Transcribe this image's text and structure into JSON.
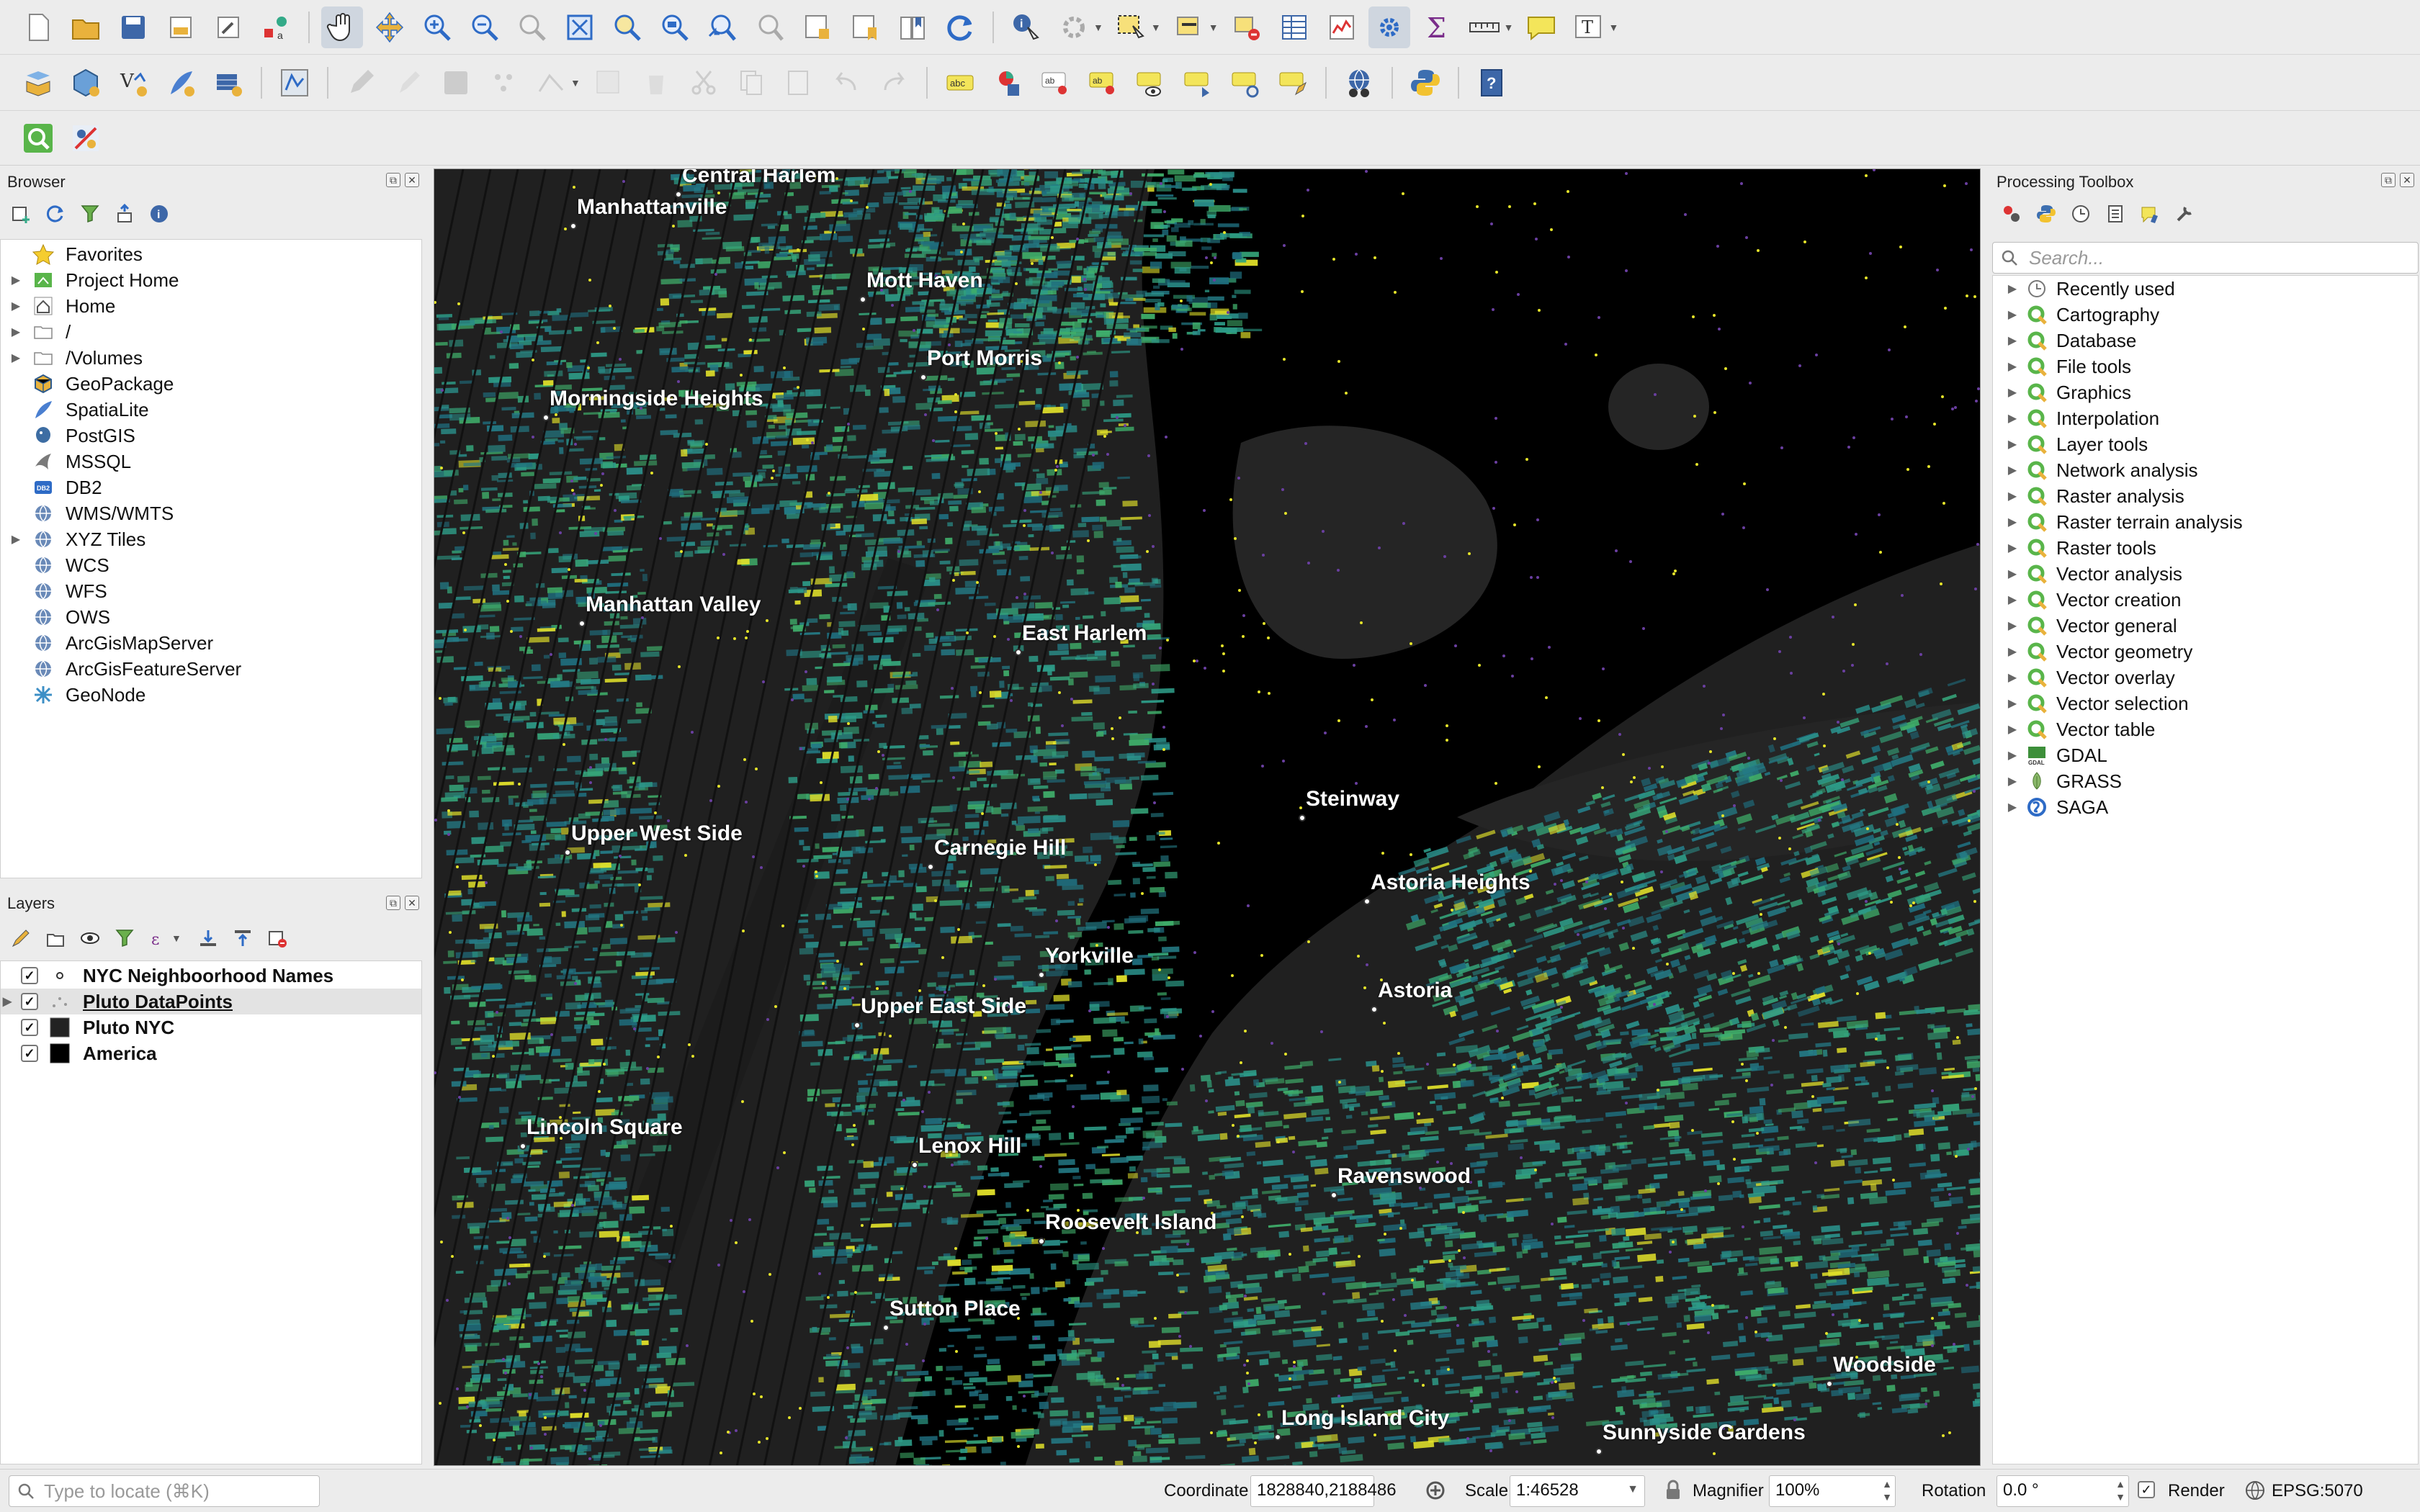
{
  "browser": {
    "title": "Browser",
    "items": [
      {
        "label": "Favorites",
        "icon": "star-icon",
        "expandable": false
      },
      {
        "label": "Project Home",
        "icon": "project-home-icon",
        "expandable": true
      },
      {
        "label": "Home",
        "icon": "home-icon",
        "expandable": true
      },
      {
        "label": "/",
        "icon": "folder-icon",
        "expandable": true
      },
      {
        "label": "/Volumes",
        "icon": "folder-icon",
        "expandable": true
      },
      {
        "label": "GeoPackage",
        "icon": "geopackage-icon",
        "expandable": false
      },
      {
        "label": "SpatiaLite",
        "icon": "spatialite-icon",
        "expandable": false
      },
      {
        "label": "PostGIS",
        "icon": "postgis-icon",
        "expandable": false
      },
      {
        "label": "MSSQL",
        "icon": "mssql-icon",
        "expandable": false
      },
      {
        "label": "DB2",
        "icon": "db2-icon",
        "expandable": false
      },
      {
        "label": "WMS/WMTS",
        "icon": "globe-icon",
        "expandable": false
      },
      {
        "label": "XYZ Tiles",
        "icon": "globe-icon",
        "expandable": true
      },
      {
        "label": "WCS",
        "icon": "globe-icon",
        "expandable": false
      },
      {
        "label": "WFS",
        "icon": "globe-icon",
        "expandable": false
      },
      {
        "label": "OWS",
        "icon": "globe-icon",
        "expandable": false
      },
      {
        "label": "ArcGisMapServer",
        "icon": "globe-icon",
        "expandable": false
      },
      {
        "label": "ArcGisFeatureServer",
        "icon": "globe-icon",
        "expandable": false
      },
      {
        "label": "GeoNode",
        "icon": "geonode-icon",
        "expandable": false
      }
    ]
  },
  "layers": {
    "title": "Layers",
    "items": [
      {
        "label": "NYC Neighboorhood Names",
        "checked": true,
        "symbol": "point",
        "selected": false,
        "expandable": false
      },
      {
        "label": "Pluto DataPoints",
        "checked": true,
        "symbol": "points",
        "selected": true,
        "expandable": true
      },
      {
        "label": "Pluto NYC",
        "checked": true,
        "symbol": "fill-dark",
        "selected": false,
        "expandable": false
      },
      {
        "label": "America",
        "checked": true,
        "symbol": "fill-black",
        "selected": false,
        "expandable": false
      }
    ]
  },
  "toolbox": {
    "title": "Processing Toolbox",
    "search_placeholder": "Search...",
    "items": [
      {
        "label": "Recently used",
        "icon": "clock-icon"
      },
      {
        "label": "Cartography",
        "icon": "qgis-icon"
      },
      {
        "label": "Database",
        "icon": "qgis-icon"
      },
      {
        "label": "File tools",
        "icon": "qgis-icon"
      },
      {
        "label": "Graphics",
        "icon": "qgis-icon"
      },
      {
        "label": "Interpolation",
        "icon": "qgis-icon"
      },
      {
        "label": "Layer tools",
        "icon": "qgis-icon"
      },
      {
        "label": "Network analysis",
        "icon": "qgis-icon"
      },
      {
        "label": "Raster analysis",
        "icon": "qgis-icon"
      },
      {
        "label": "Raster terrain analysis",
        "icon": "qgis-icon"
      },
      {
        "label": "Raster tools",
        "icon": "qgis-icon"
      },
      {
        "label": "Vector analysis",
        "icon": "qgis-icon"
      },
      {
        "label": "Vector creation",
        "icon": "qgis-icon"
      },
      {
        "label": "Vector general",
        "icon": "qgis-icon"
      },
      {
        "label": "Vector geometry",
        "icon": "qgis-icon"
      },
      {
        "label": "Vector overlay",
        "icon": "qgis-icon"
      },
      {
        "label": "Vector selection",
        "icon": "qgis-icon"
      },
      {
        "label": "Vector table",
        "icon": "qgis-icon"
      },
      {
        "label": "GDAL",
        "icon": "gdal-icon"
      },
      {
        "label": "GRASS",
        "icon": "grass-icon"
      },
      {
        "label": "SAGA",
        "icon": "saga-icon"
      }
    ]
  },
  "map": {
    "neighborhoods": [
      "Central Harlem",
      "Manhattanville",
      "Mott Haven",
      "Port Morris",
      "Morningside Heights",
      "Manhattan Valley",
      "East Harlem",
      "Upper West Side",
      "Carnegie Hill",
      "Steinway",
      "Astoria Heights",
      "Yorkville",
      "Upper East Side",
      "Astoria",
      "Lincoln Square",
      "Lenox Hill",
      "Ravenswood",
      "Roosevelt Island",
      "Sutton Place",
      "Woodside",
      "Long Island City",
      "Sunnyside Gardens"
    ]
  },
  "status": {
    "locate_placeholder": "Type to locate (⌘K)",
    "coordinate_label": "Coordinate",
    "coordinate_value": "1828840,2188486",
    "scale_label": "Scale",
    "scale_value": "1:46528",
    "magnifier_label": "Magnifier",
    "magnifier_value": "100%",
    "rotation_label": "Rotation",
    "rotation_value": "0.0 °",
    "render_label": "Render",
    "render_checked": true,
    "crs": "EPSG:5070"
  },
  "colors": {
    "map_background": "#202020",
    "parcel_teal": "#2a8f8a",
    "parcel_green": "#3fae6a",
    "highlight_yellow": "#e4e32a",
    "accent_blue": "#2e6bc6"
  }
}
